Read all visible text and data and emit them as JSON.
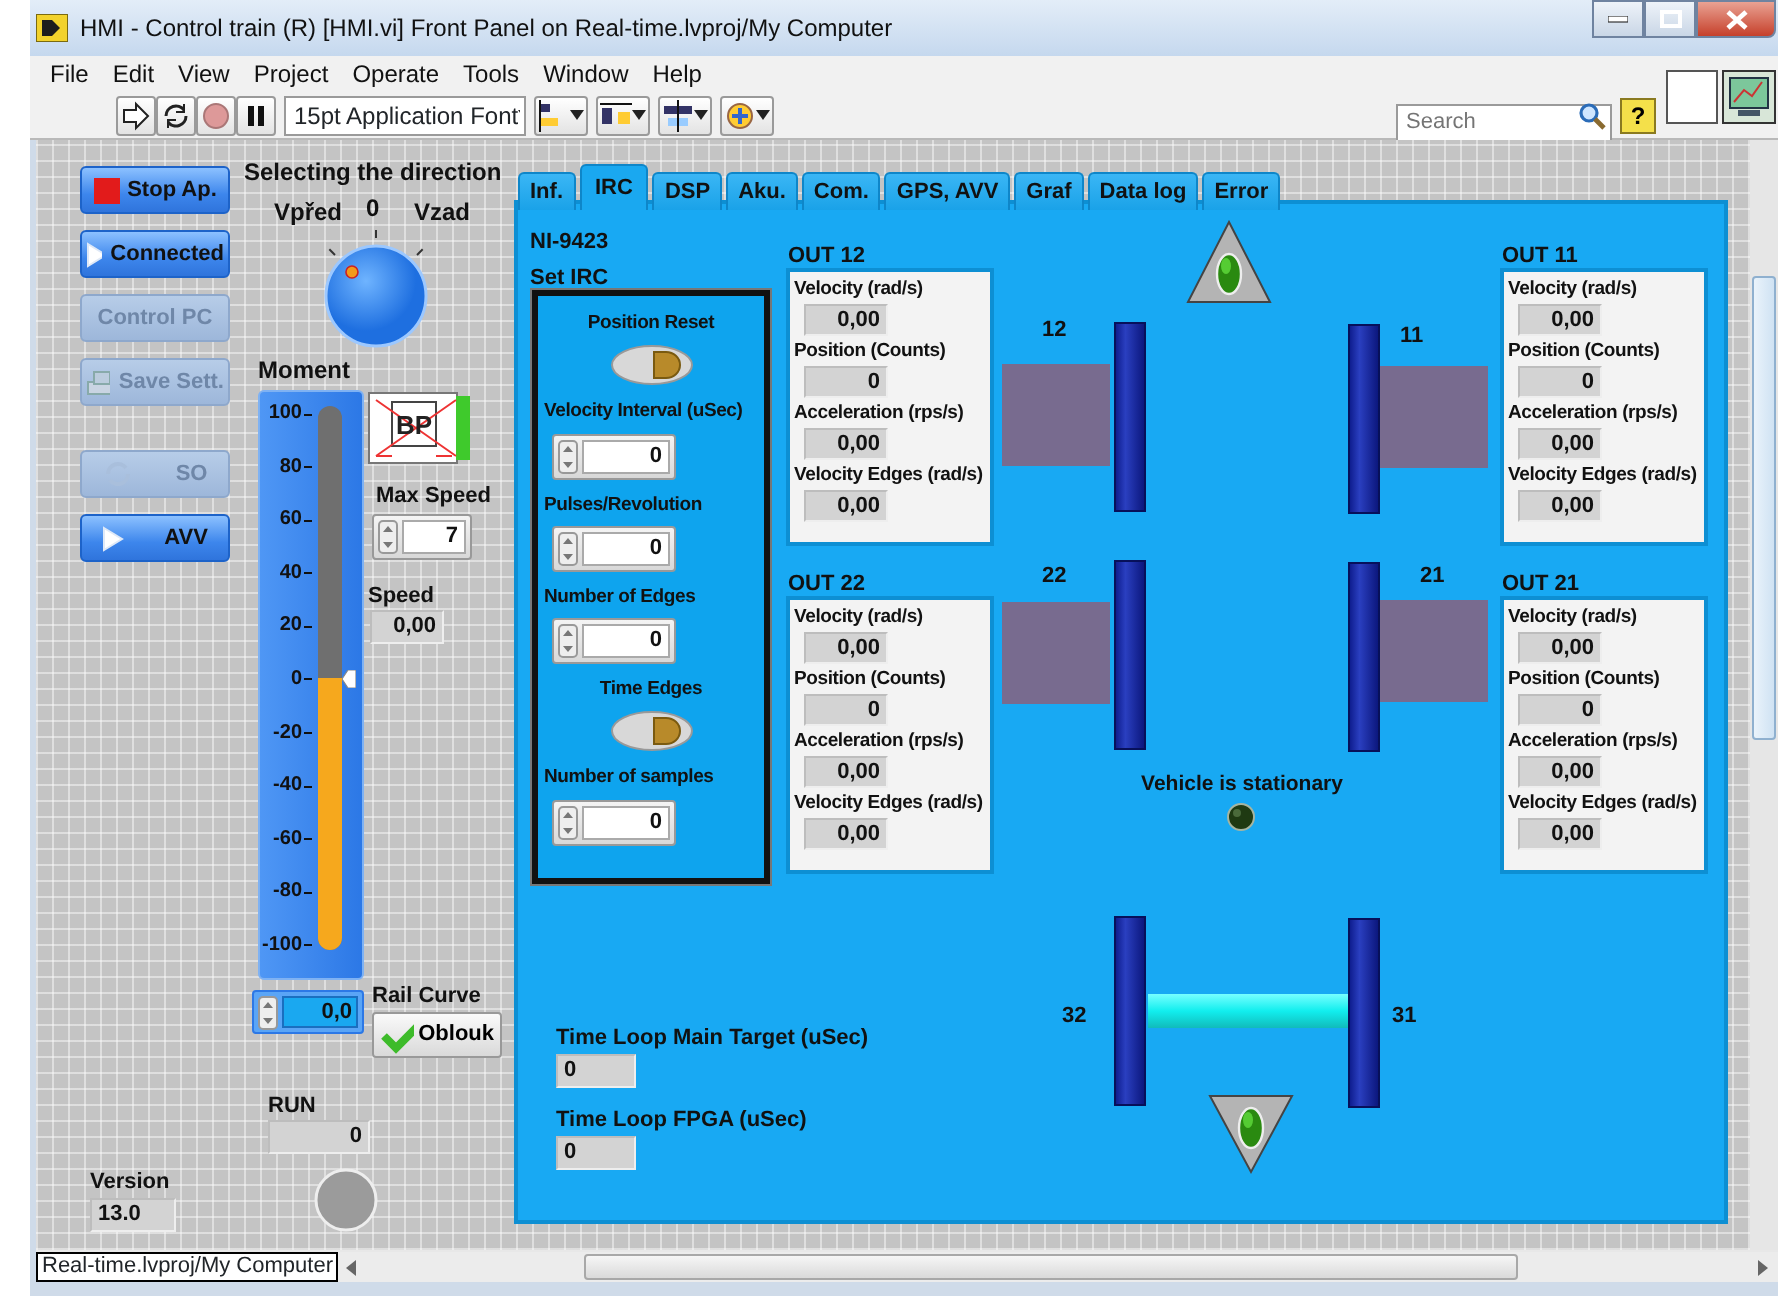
{
  "window": {
    "title": "HMI - Control train (R) [HMI.vi] Front Panel on Real-time.lvproj/My Computer"
  },
  "menu": [
    "File",
    "Edit",
    "View",
    "Project",
    "Operate",
    "Tools",
    "Window",
    "Help"
  ],
  "toolbar": {
    "font": "15pt Application Font",
    "search": {
      "placeholder": "Search"
    },
    "help": "?"
  },
  "buttons": [
    {
      "label": "Stop Ap.",
      "kind": "stop",
      "disabled": false
    },
    {
      "label": "Connected",
      "kind": "play",
      "disabled": false
    },
    {
      "label": "Control  PC",
      "kind": "plain",
      "disabled": true
    },
    {
      "label": "Save Sett.",
      "kind": "save",
      "disabled": true
    },
    {
      "label": "SO",
      "kind": "refresh",
      "disabled": true
    },
    {
      "label": "AVV",
      "kind": "play",
      "disabled": false
    }
  ],
  "direction": {
    "title": "Selecting the direction",
    "labels": [
      "Vpřed",
      "0",
      "Vzad"
    ]
  },
  "moment": {
    "title": "Moment",
    "ticks": [
      "100",
      "80",
      "60",
      "40",
      "20",
      "0",
      "-20",
      "-40",
      "-60",
      "-80",
      "-100"
    ],
    "level": 0.5,
    "value": "0,0"
  },
  "bp_indicator": {
    "text": "BP"
  },
  "max_speed": {
    "label": "Max Speed",
    "value": "7"
  },
  "speed": {
    "label": "Speed",
    "value": "0,00"
  },
  "rail_curve": {
    "label": "Rail Curve",
    "button": "Oblouk",
    "on": true
  },
  "run": {
    "label": "RUN",
    "value": "0"
  },
  "version": {
    "label": "Version",
    "value": "13.0"
  },
  "tabs": [
    {
      "label": "Inf.",
      "selected": false
    },
    {
      "label": "IRC",
      "selected": true
    },
    {
      "label": "DSP",
      "selected": false
    },
    {
      "label": "Aku.",
      "selected": false
    },
    {
      "label": "Com.",
      "selected": false
    },
    {
      "label": "GPS, AVV",
      "selected": false
    },
    {
      "label": "Graf",
      "selected": false
    },
    {
      "label": "Data log",
      "selected": false
    },
    {
      "label": "Error",
      "selected": false
    }
  ],
  "irc": {
    "module": "NI-9423",
    "title": "Set IRC",
    "settings": [
      {
        "kind": "toggle",
        "label": "Position Reset"
      },
      {
        "kind": "numeric",
        "label": "Velocity Interval (uSec)",
        "value": "0"
      },
      {
        "kind": "numeric",
        "label": "Pulses/Revolution",
        "value": "0"
      },
      {
        "kind": "numeric",
        "label": "Number of Edges",
        "value": "0"
      },
      {
        "kind": "toggle",
        "label": "Time Edges"
      },
      {
        "kind": "numeric",
        "label": "Number of samples",
        "value": "0"
      }
    ]
  },
  "outputs": [
    {
      "title": "OUT 12",
      "fields": [
        {
          "label": "Velocity (rad/s)",
          "value": "0,00"
        },
        {
          "label": "Position (Counts)",
          "value": "0"
        },
        {
          "label": "Acceleration (rps/s)",
          "value": "0,00"
        },
        {
          "label": "Velocity Edges (rad/s)",
          "value": "0,00"
        }
      ]
    },
    {
      "title": "OUT 11",
      "fields": [
        {
          "label": "Velocity (rad/s)",
          "value": "0,00"
        },
        {
          "label": "Position (Counts)",
          "value": "0"
        },
        {
          "label": "Acceleration (rps/s)",
          "value": "0,00"
        },
        {
          "label": "Velocity Edges (rad/s)",
          "value": "0,00"
        }
      ]
    },
    {
      "title": "OUT 22",
      "fields": [
        {
          "label": "Velocity (rad/s)",
          "value": "0,00"
        },
        {
          "label": "Position (Counts)",
          "value": "0"
        },
        {
          "label": "Acceleration (rps/s)",
          "value": "0,00"
        },
        {
          "label": "Velocity Edges (rad/s)",
          "value": "0,00"
        }
      ]
    },
    {
      "title": "OUT 21",
      "fields": [
        {
          "label": "Velocity (rad/s)",
          "value": "0,00"
        },
        {
          "label": "Position (Counts)",
          "value": "0"
        },
        {
          "label": "Acceleration (rps/s)",
          "value": "0,00"
        },
        {
          "label": "Velocity Edges (rad/s)",
          "value": "0,00"
        }
      ]
    }
  ],
  "wheels": [
    {
      "label": "12"
    },
    {
      "label": "11"
    },
    {
      "label": "22"
    },
    {
      "label": "21"
    }
  ],
  "rear_wheels": [
    {
      "label": "32"
    },
    {
      "label": "31"
    }
  ],
  "indicators": [
    {
      "on": true
    },
    {
      "on": true
    }
  ],
  "vehicle_status": {
    "text": "Vehicle is stationary",
    "on": false
  },
  "time_loops": [
    {
      "label": "Time Loop Main Target (uSec)",
      "value": "0"
    },
    {
      "label": "Time Loop FPGA (uSec)",
      "value": "0"
    }
  ],
  "status_bar": {
    "path": "Real-time.lvproj/My Computer"
  }
}
